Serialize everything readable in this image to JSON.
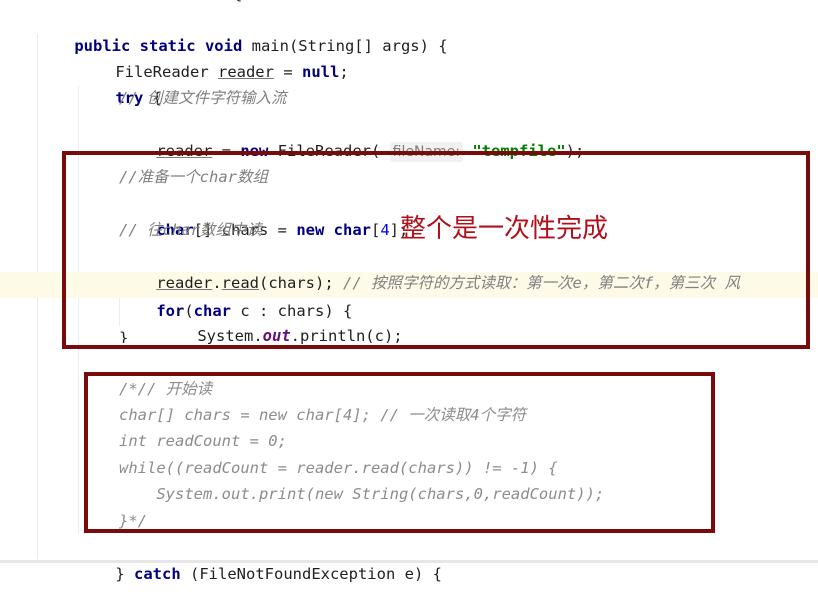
{
  "annotation": "整个是一次性完成",
  "top_partial": "{",
  "code": {
    "main_sig": {
      "kw": "public static void",
      "rest": " main(String[] args) {"
    },
    "reader_decl": {
      "type": "FileReader ",
      "var": "reader",
      "eq": " = ",
      "null_kw": "null",
      "semi": ";"
    },
    "try_line": {
      "kw": "try",
      "rest": " {"
    },
    "comment_create": "// 创建文件字符输入流",
    "reader_assign": {
      "var": "reader",
      "eq": " = ",
      "new_kw": "new",
      "ctor": " FileReader( ",
      "hint": "fileName:",
      "str": "\"tempfile\"",
      "end": ");"
    },
    "comment_prepare": "//准备一个char数组",
    "chars_decl": {
      "kw1": "char",
      "mid": "[] chars = ",
      "new_kw": "new",
      "sp": " ",
      "kw2": "char",
      "open": "[",
      "num": "4",
      "close": "];"
    },
    "comment_read_into": "// 往char数组中读",
    "read_call": {
      "var": "reader",
      "dot": ".",
      "method": "read",
      "args": "(chars);",
      "comment": " // 按照字符的方式读取：第一次e，第二次f，第三次 风"
    },
    "for_line": {
      "kw": "for",
      "open": "(",
      "kw2": "char",
      "rest": " c : chars) {"
    },
    "println_line": {
      "pre": "System.",
      "field": "out",
      "post": ".println(c);"
    },
    "close_brace": "}",
    "block_comment": [
      "/*// 开始读",
      "char[] chars = new char[4]; // 一次读取4个字符",
      "int readCount = 0;",
      "while((readCount = reader.read(chars)) != -1) {",
      "    System.out.print(new String(chars,0,readCount));",
      "}*/"
    ],
    "catch_line": {
      "pre": "} ",
      "kw": "catch",
      "rest": " (FileNotFoundException e) {"
    }
  }
}
